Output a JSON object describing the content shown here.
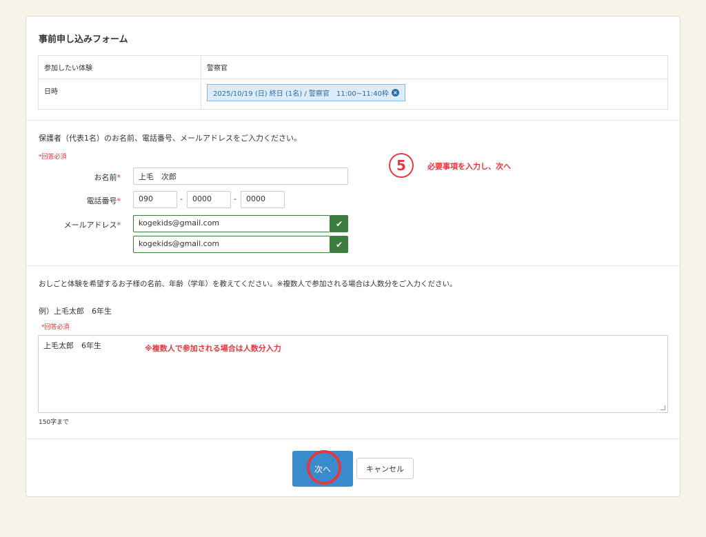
{
  "form": {
    "title": "事前申し込みフォーム",
    "info": {
      "experience_label": "参加したい体験",
      "experience_value": "警察官",
      "datetime_label": "日時",
      "datetime_chip": "2025/10/19 (日) 終日 (1名) / 警察官　11:00~11:40枠",
      "chip_close_icon": "close-circle-icon"
    },
    "guardian": {
      "intro": "保護者（代表1名）のお名前、電話番号、メールアドレスをご入力ください。",
      "required_note": "*回答必須",
      "name_label": "お名前",
      "name_value": "上毛　次郎",
      "phone_label": "電話番号",
      "phone1": "090",
      "phone2": "0000",
      "phone3": "0000",
      "phone_sep": "-",
      "email_label": "メールアドレス",
      "email_value": "kogekids@gmail.com",
      "email_confirm_value": "kogekids@gmail.com",
      "required_star": "*"
    },
    "children": {
      "question": "おしごと体験を希望するお子様の名前、年齢（学年）を教えてください。※複数人で参加される場合は人数分をご入力ください。",
      "example": "例）上毛太郎　6年生",
      "required_note": "*回答必須",
      "value": "上毛太郎　6年生",
      "limit": "150字まで"
    },
    "buttons": {
      "next": "次へ",
      "cancel": "キャンセル"
    }
  },
  "annotations": {
    "step_number": "5",
    "step_text": "必要事項を入力し、次へ",
    "multi_note": "※複数人で参加される場合は人数分入力"
  },
  "colors": {
    "background": "#f7f3e8",
    "primary": "#3a8bcd",
    "valid_green": "#3d7d3f",
    "annotation_red": "#e4383f"
  }
}
